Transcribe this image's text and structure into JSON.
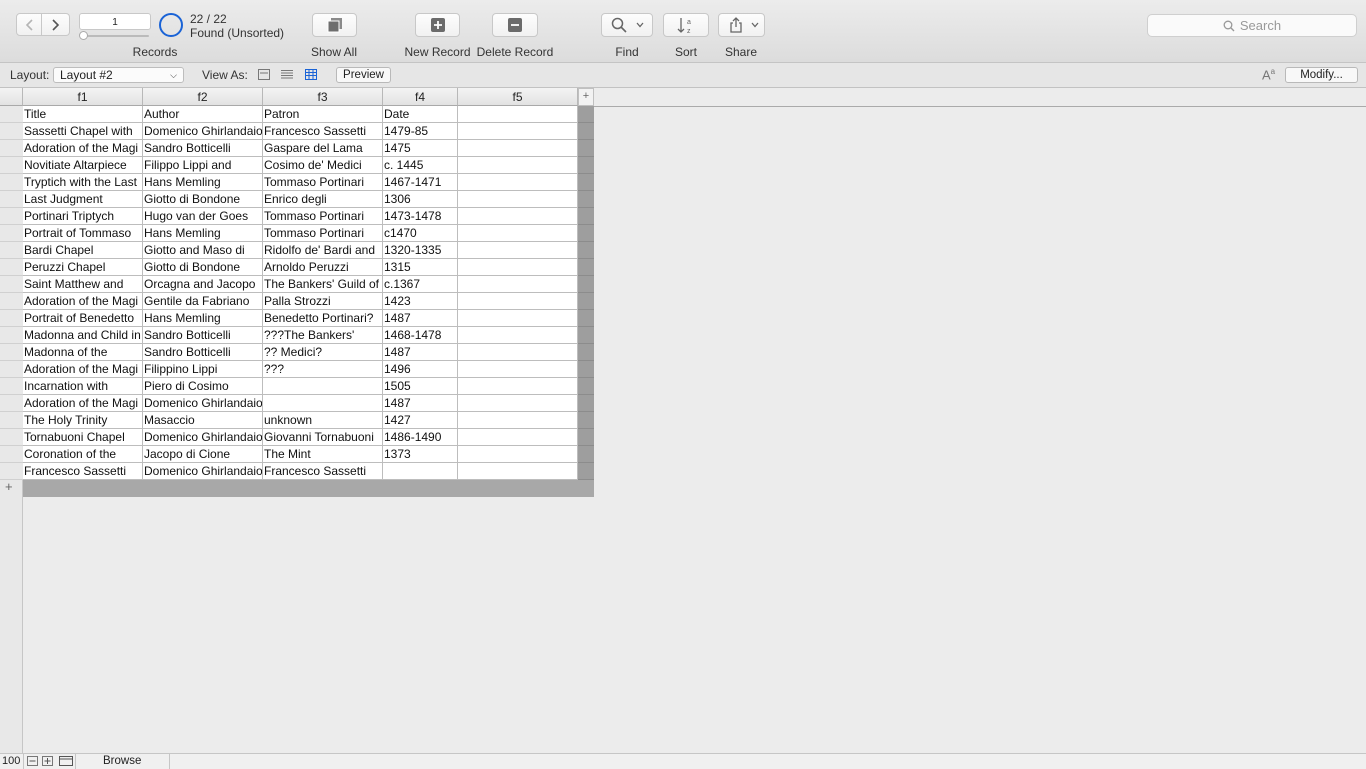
{
  "toolbar": {
    "records_label": "Records",
    "record_number": "1",
    "record_count": "22 / 22",
    "found_status": "Found (Unsorted)",
    "show_all_label": "Show All",
    "new_record_label": "New Record",
    "delete_record_label": "Delete Record",
    "find_label": "Find",
    "sort_label": "Sort",
    "share_label": "Share",
    "search_placeholder": "Search"
  },
  "layout_bar": {
    "layout_label": "Layout:",
    "layout_value": "Layout #2",
    "view_as_label": "View As:",
    "preview_label": "Preview",
    "modify_label": "Modify..."
  },
  "table": {
    "columns": [
      "f1",
      "f2",
      "f3",
      "f4",
      "f5"
    ],
    "rows": [
      [
        "Title",
        "Author",
        "Patron",
        "Date",
        ""
      ],
      [
        "Sassetti Chapel with",
        "Domenico Ghirlandaio",
        "Francesco Sassetti",
        "1479-85",
        ""
      ],
      [
        "Adoration of the Magi",
        "Sandro Botticelli",
        "Gaspare del Lama",
        "1475",
        ""
      ],
      [
        "Novitiate Altarpiece",
        "Filippo Lippi and",
        "Cosimo de' Medici",
        "c. 1445",
        ""
      ],
      [
        "Tryptich with the Last",
        "Hans Memling",
        "Tommaso Portinari",
        "1467-1471",
        ""
      ],
      [
        "Last Judgment",
        "Giotto di Bondone",
        "Enrico degli",
        "1306",
        ""
      ],
      [
        "Portinari Triptych",
        "Hugo van der Goes",
        "Tommaso Portinari",
        "1473-1478",
        ""
      ],
      [
        "Portrait of Tommaso",
        "Hans Memling",
        "Tommaso Portinari",
        "c1470",
        ""
      ],
      [
        "Bardi Chapel",
        " Giotto and Maso di",
        "Ridolfo de' Bardi and",
        "1320-1335",
        ""
      ],
      [
        "Peruzzi Chapel",
        "Giotto di Bondone",
        "Arnoldo Peruzzi",
        "1315",
        ""
      ],
      [
        "Saint Matthew and",
        "Orcagna and Jacopo",
        "The Bankers' Guild of",
        "c.1367",
        ""
      ],
      [
        "Adoration of the Magi",
        "Gentile da Fabriano",
        "Palla Strozzi",
        "1423",
        ""
      ],
      [
        "Portrait of Benedetto",
        "Hans Memling",
        "Benedetto Portinari?",
        "1487",
        ""
      ],
      [
        "Madonna and Child in",
        "Sandro Botticelli",
        "???The Bankers'",
        "1468-1478",
        ""
      ],
      [
        "Madonna of the",
        "Sandro Botticelli",
        "?? Medici?",
        "1487",
        ""
      ],
      [
        "Adoration of the Magi",
        "Filippino Lippi",
        "???",
        "1496",
        ""
      ],
      [
        "Incarnation with",
        "Piero di Cosimo",
        "",
        "1505",
        ""
      ],
      [
        "Adoration of the Magi",
        "Domenico Ghirlandaio",
        "",
        "1487",
        ""
      ],
      [
        "The Holy Trinity",
        "Masaccio",
        "unknown",
        "1427",
        ""
      ],
      [
        "Tornabuoni Chapel",
        "Domenico Ghirlandaio",
        "Giovanni Tornabuoni",
        "1486-1490",
        ""
      ],
      [
        "Coronation of the",
        "Jacopo di Cione",
        "The Mint",
        "1373",
        ""
      ],
      [
        "Francesco Sassetti",
        "Domenico Ghirlandaio",
        "Francesco Sassetti",
        "",
        ""
      ]
    ]
  },
  "statusbar": {
    "zoom": "100",
    "mode": "Browse"
  },
  "colors": {
    "accent": "#1a63d6",
    "row_gutter": "#9e9e9e"
  }
}
